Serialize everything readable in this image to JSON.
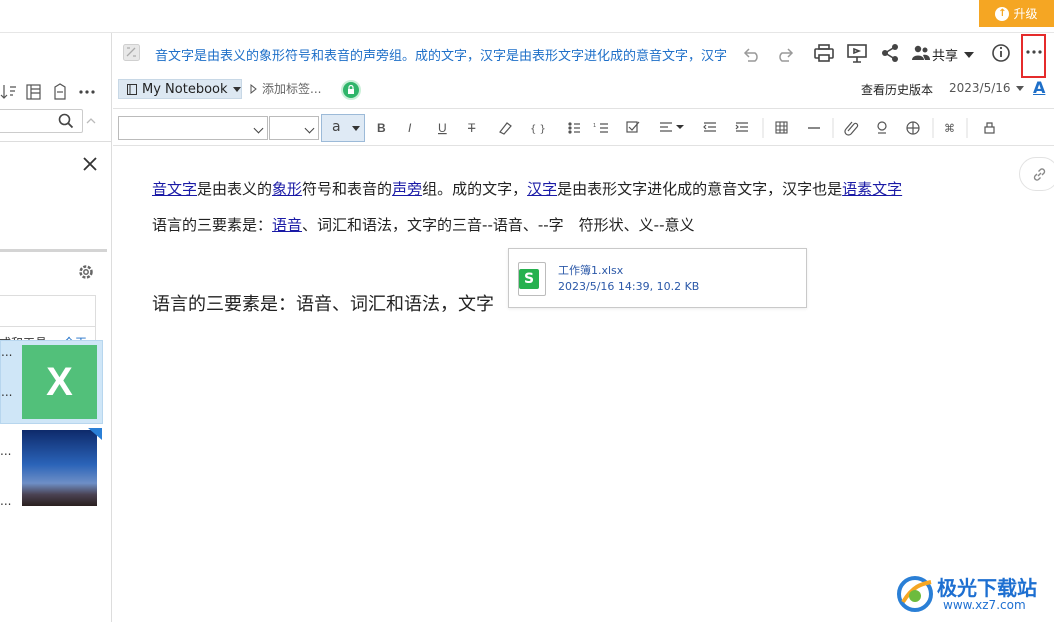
{
  "upgrade": {
    "label": "升级"
  },
  "left": {
    "tag_row": {
      "label": "式和工具...",
      "date": "今天"
    },
    "note_items": [
      {
        "snippet": "..."
      },
      {
        "snippet": "..."
      },
      {
        "snippet": "..."
      },
      {
        "snippet": "..."
      }
    ]
  },
  "note": {
    "title": "音文字是由表义的象形符号和表音的声旁组。成的文字，汉字是由表形文字进化成的意音文字，汉字",
    "notebook": "My Notebook",
    "add_tag": "添加标签...",
    "history": "查看历史版本",
    "date": "2023/5/16",
    "share": "共享",
    "font_a": "A"
  },
  "format": {
    "color_label": "a"
  },
  "content": {
    "para1": [
      {
        "t": "音文字",
        "link": true
      },
      {
        "t": "是由表义的",
        "link": false
      },
      {
        "t": "象形",
        "link": true
      },
      {
        "t": "符号和表音的",
        "link": false
      },
      {
        "t": "声旁",
        "link": true
      },
      {
        "t": "组。成的文字，",
        "link": false
      },
      {
        "t": "汉字",
        "link": true
      },
      {
        "t": "是由表形文字进化成的意音文字，汉字也是",
        "link": false
      },
      {
        "t": "语素文字",
        "link": true
      }
    ],
    "para2": [
      {
        "t": "语言的三要素是：",
        "link": false
      },
      {
        "t": "语音",
        "link": true
      },
      {
        "t": "、词汇和语法，文字的三音--语音、--字　符形状、义--意义",
        "link": false
      }
    ],
    "para3": "语言的三要素是：语音、词汇和语法，文字"
  },
  "attachment": {
    "name": "工作簿1.xlsx",
    "meta": "2023/5/16 14:39, 10.2 KB",
    "badge": "S"
  },
  "watermark": {
    "title": "极光下载站",
    "url": "www.xz7.com"
  },
  "colors": {
    "accent": "#1e6fc8",
    "upgrade": "#f5a623",
    "highlight": "#e52b2b",
    "excel": "#52c07a"
  }
}
